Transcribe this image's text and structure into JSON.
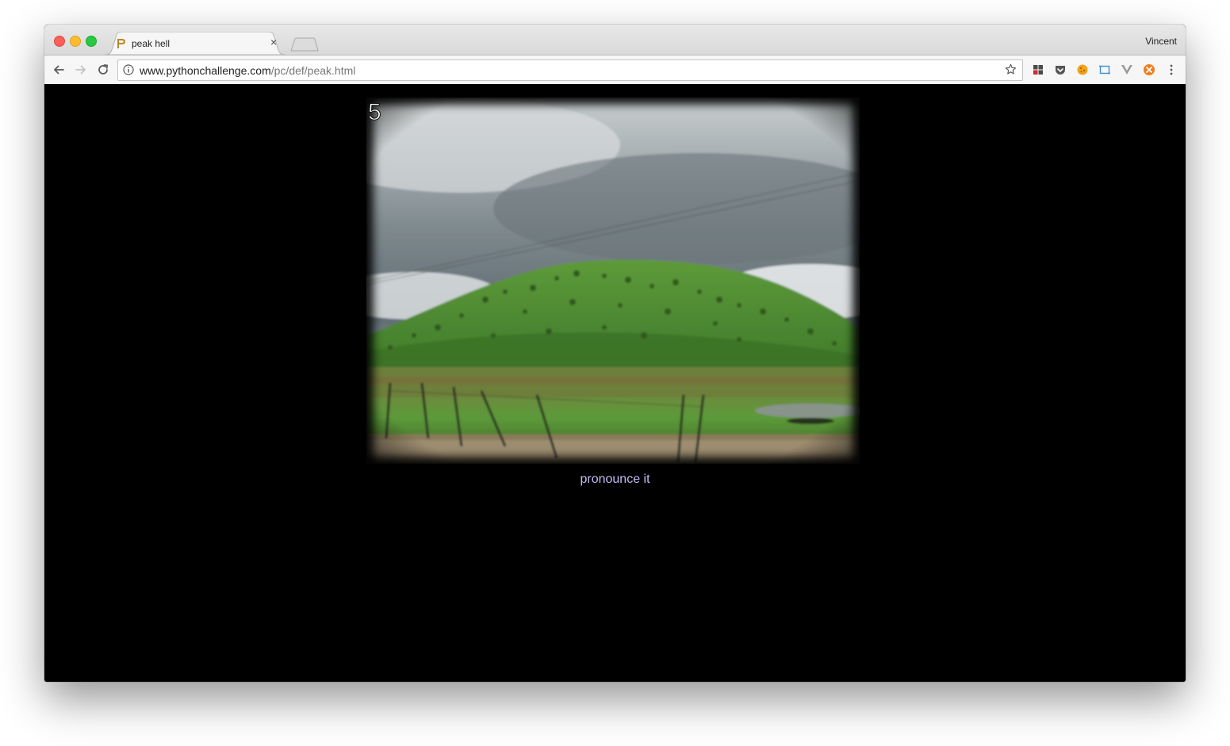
{
  "window": {
    "profile_name": "Vincent"
  },
  "tab": {
    "title": "peak hell",
    "close_glyph": "×",
    "favicon": "pythonchallenge-favicon"
  },
  "toolbar": {
    "url_host": "www.pythonchallenge.com",
    "url_path": "/pc/def/peak.html",
    "icons": [
      "back-icon",
      "forward-icon",
      "reload-icon",
      "info-icon",
      "star-icon"
    ],
    "extensions": [
      "puzzle-extension-icon",
      "pocket-icon",
      "cookie-icon",
      "screenshot-icon",
      "vue-devtools-icon",
      "orange-extension-icon",
      "menu-kebab-icon"
    ]
  },
  "page": {
    "image_number": "5",
    "link_text": "pronounce it",
    "link_color": "#c6b9f5",
    "background": "#000000"
  }
}
